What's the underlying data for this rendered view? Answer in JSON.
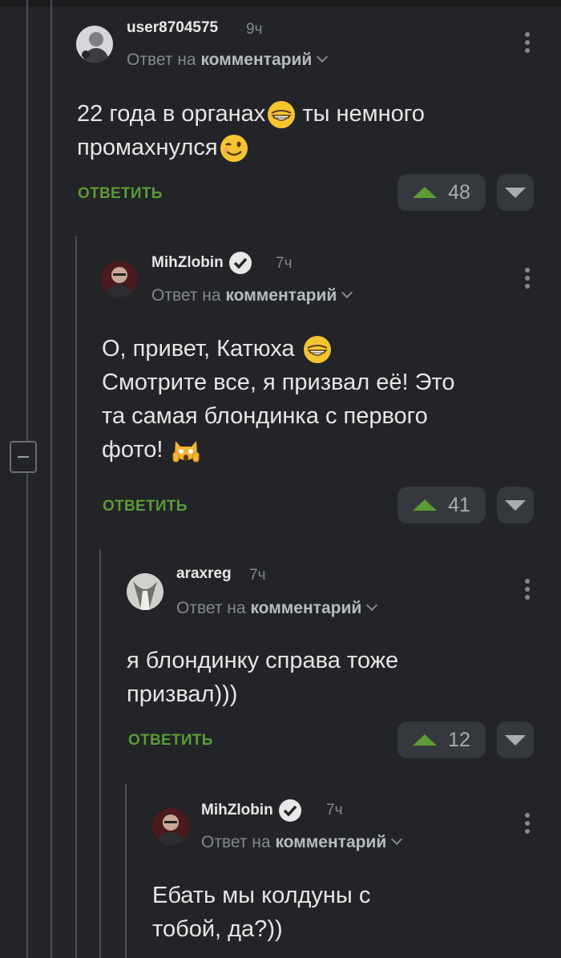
{
  "reply_prefix": "Ответ на",
  "reply_target": "комментарий",
  "reply_label": "ОТВЕТИТЬ",
  "colors": {
    "background": "#222427",
    "accent_green": "#5b9c35",
    "muted": "#85888d"
  },
  "comments": [
    {
      "username": "user8704575",
      "time": "9ч",
      "verified": false,
      "text_lines": [
        "22 года в органах",
        "ты немного",
        "промахнулся"
      ],
      "emojis": [
        "grinning-emoji",
        "winking-emoji"
      ],
      "votes": "48"
    },
    {
      "username": "MihZlobin",
      "time": "7ч",
      "verified": true,
      "text_lines": [
        "О, привет, Катюха",
        "Смотрите все, я призвал её! Это",
        "та самая блондинка с первого",
        "фото!"
      ],
      "emojis": [
        "grinning-emoji",
        "scared-cat-emoji"
      ],
      "votes": "41"
    },
    {
      "username": "araxreg",
      "time": "7ч",
      "verified": false,
      "text_lines": [
        "я блондинку справа тоже",
        "призвал)))"
      ],
      "votes": "12"
    },
    {
      "username": "MihZlobin",
      "time": "7ч",
      "verified": true,
      "text_lines": [
        "Ебать мы колдуны с",
        "тобой, да?))"
      ]
    }
  ]
}
